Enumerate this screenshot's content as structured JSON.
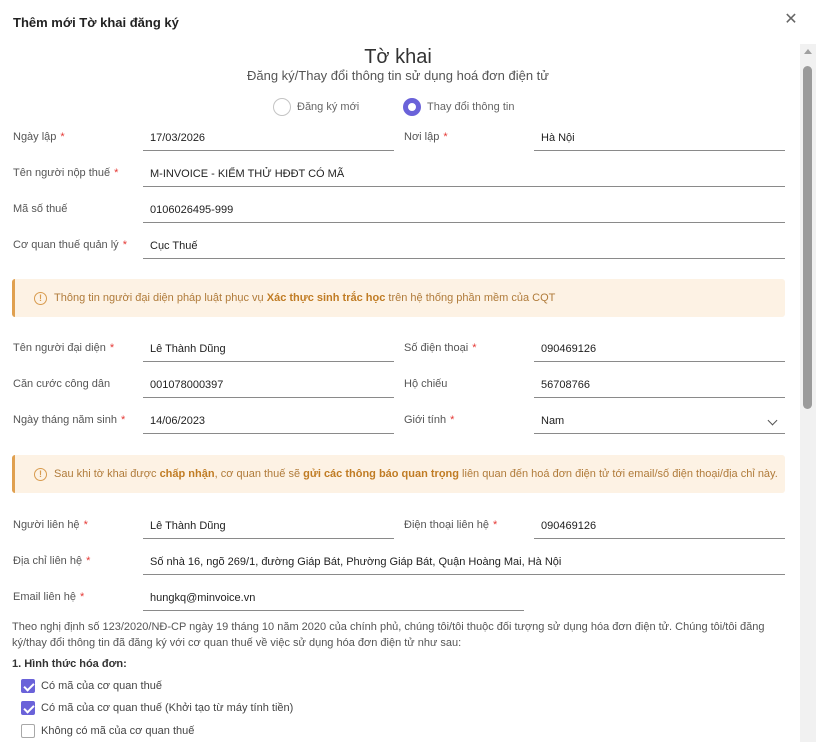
{
  "dialog": {
    "title": "Thêm mới Tờ khai đăng ký",
    "close_icon": "close-icon"
  },
  "form": {
    "title": "Tờ khai",
    "subtitle": "Đăng ký/Thay đổi thông tin sử dụng hoá đơn điện tử",
    "radio": [
      {
        "label": "Đăng ký mới",
        "checked": false
      },
      {
        "label": "Thay đổi thông tin",
        "checked": true
      }
    ]
  },
  "fields": {
    "ngay_lap": {
      "label": "Ngày lập",
      "value": "17/03/2026"
    },
    "noi_lap": {
      "label": "Nơi lập",
      "value": "Hà Nội"
    },
    "ten_nnt": {
      "label": "Tên người nộp thuế",
      "value": "M-INVOICE - KIỂM THỬ HĐĐT CÓ MÃ"
    },
    "mst": {
      "label": "Mã số thuế",
      "value": "0106026495-999"
    },
    "cqt": {
      "label": "Cơ quan thuế quản lý",
      "value": "Cục Thuế"
    },
    "ten_ndd": {
      "label": "Tên người đại diện",
      "value": "Lê Thành Dũng"
    },
    "sdt": {
      "label": "Số điện thoại",
      "value": "090469126"
    },
    "cccd": {
      "label": "Căn cước công dân",
      "value": "001078000397"
    },
    "ho_chieu": {
      "label": "Hộ chiếu",
      "value": "56708766"
    },
    "ngay_sinh": {
      "label": "Ngày tháng năm sinh",
      "value": "14/06/2023"
    },
    "gioi_tinh": {
      "label": "Giới tính",
      "value": "Nam"
    },
    "nguoi_lh": {
      "label": "Người liên hệ",
      "value": "Lê Thành Dũng"
    },
    "dt_lh": {
      "label": "Điện thoại liên hệ",
      "value": "090469126"
    },
    "dia_chi_lh": {
      "label": "Địa chỉ liên hệ",
      "value": "Số nhà 16, ngõ 269/1, đường Giáp Bát, Phường Giáp Bát, Quận Hoàng Mai, Hà Nội"
    },
    "email_lh": {
      "label": "Email liên hệ",
      "value": "hungkq@minvoice.vn"
    }
  },
  "notice1": {
    "pre": "Thông tin người đại diện pháp luật phục vụ ",
    "bold": "Xác thực sinh trắc học",
    "post": " trên hệ thống phần mềm của CQT"
  },
  "notice2": {
    "pre": "Sau khi tờ khai được ",
    "bold1": "chấp nhận",
    "mid": ", cơ quan thuế sẽ ",
    "bold2": "gửi các thông báo quan trọng",
    "post": " liên quan đến hoá đơn điện tử tới email/số điện thoại/địa chỉ này."
  },
  "paragraph": "Theo nghị định số 123/2020/NĐ-CP ngày 19 tháng 10 năm 2020 của chính phủ, chúng tôi/tôi thuộc đối tượng sử dụng hóa đơn điện tử. Chúng tôi/tôi đăng ký/thay đổi thông tin đã đăng ký với cơ quan thuế về việc sử dụng hóa đơn điện tử như sau:",
  "section1": {
    "title": "1. Hình thức hóa đơn:",
    "options": [
      {
        "label": "Có mã của cơ quan thuế",
        "checked": true
      },
      {
        "label": "Có mã của cơ quan thuế (Khởi tạo từ máy tính tiền)",
        "checked": true
      },
      {
        "label": "Không có mã của cơ quan thuế",
        "checked": false
      }
    ]
  },
  "colors": {
    "accent": "#6a62d9",
    "required": "#e53935",
    "notice_bg": "#fdf2e4",
    "notice_border": "#e0a04f"
  }
}
